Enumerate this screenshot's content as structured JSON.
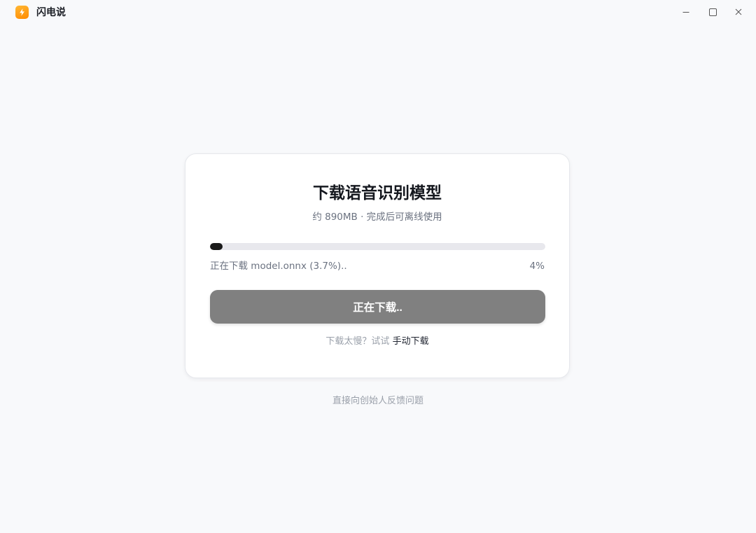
{
  "window": {
    "app_title": "闪电说",
    "app_icon": "lightning-icon",
    "controls": [
      "minimize-icon",
      "maximize-icon",
      "close-icon"
    ]
  },
  "card": {
    "title": "下载语音识别模型",
    "subtitle": "约 890MB · 完成后可离线使用",
    "progress": {
      "fraction": 0.037,
      "status_text": "正在下载 model.onnx (3.7%)..",
      "percent_label": "4%"
    },
    "button_label": "正在下载..",
    "help_prefix": "下载太慢？试试 ",
    "help_link": "手动下载"
  },
  "feedback_link": "直接向创始人反馈问题",
  "colors": {
    "background": "#f8f9fb",
    "accent_icon": "#ff9a1a",
    "progress_fill": "#1a1a1a",
    "progress_track": "#e8e8ed",
    "button_disabled": "#808080"
  }
}
